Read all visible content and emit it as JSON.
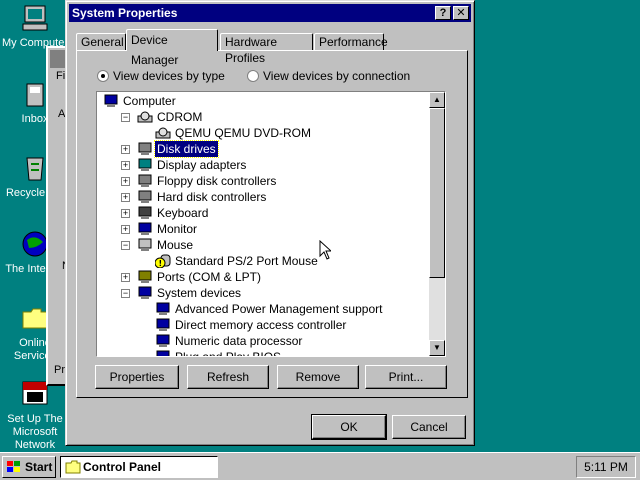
{
  "desktop": {
    "icons": [
      {
        "label": "My Computer",
        "icon": "my-computer-icon"
      },
      {
        "label": "Inbox",
        "icon": "inbox-icon"
      },
      {
        "label": "Recycle Bin",
        "icon": "recycle-bin-icon"
      },
      {
        "label": "The Internet",
        "icon": "internet-icon"
      },
      {
        "label": "Online Services",
        "icon": "folder-icon"
      },
      {
        "label": "Set Up The Microsoft Network",
        "icon": "msn-icon"
      }
    ]
  },
  "background_window": {
    "menu_fragment": "File",
    "fragment_a": "A",
    "fragment_n": "N",
    "fragment_pro": "Pro"
  },
  "dialog": {
    "title": "System Properties",
    "help_button": "?",
    "close_button": "✕",
    "tabs": [
      {
        "label": "General",
        "active": false
      },
      {
        "label": "Device Manager",
        "active": true
      },
      {
        "label": "Hardware Profiles",
        "active": false
      },
      {
        "label": "Performance",
        "active": false
      }
    ],
    "view_options": {
      "by_type": {
        "label": "View devices by type",
        "selected": true
      },
      "by_connection": {
        "label": "View devices by connection",
        "selected": false
      }
    },
    "device_tree": [
      {
        "label": "Computer",
        "icon": "computer-icon",
        "level": 0,
        "expander": ""
      },
      {
        "label": "CDROM",
        "icon": "cdrom-icon",
        "level": 1,
        "expander": "−"
      },
      {
        "label": "QEMU QEMU DVD-ROM",
        "icon": "cdrom-icon",
        "level": 2,
        "expander": ""
      },
      {
        "label": "Disk drives",
        "icon": "disk-drive-icon",
        "level": 1,
        "expander": "+",
        "selected": true
      },
      {
        "label": "Display adapters",
        "icon": "display-adapter-icon",
        "level": 1,
        "expander": "+"
      },
      {
        "label": "Floppy disk controllers",
        "icon": "floppy-controller-icon",
        "level": 1,
        "expander": "+"
      },
      {
        "label": "Hard disk controllers",
        "icon": "hard-disk-controller-icon",
        "level": 1,
        "expander": "+"
      },
      {
        "label": "Keyboard",
        "icon": "keyboard-icon",
        "level": 1,
        "expander": "+"
      },
      {
        "label": "Monitor",
        "icon": "monitor-icon",
        "level": 1,
        "expander": "+"
      },
      {
        "label": "Mouse",
        "icon": "mouse-icon",
        "level": 1,
        "expander": "−"
      },
      {
        "label": "Standard PS/2 Port Mouse",
        "icon": "warning-mouse-icon",
        "level": 2,
        "expander": ""
      },
      {
        "label": "Ports (COM & LPT)",
        "icon": "ports-icon",
        "level": 1,
        "expander": "+"
      },
      {
        "label": "System devices",
        "icon": "system-devices-icon",
        "level": 1,
        "expander": "−"
      },
      {
        "label": "Advanced Power Management support",
        "icon": "system-device-icon",
        "level": 2,
        "expander": ""
      },
      {
        "label": "Direct memory access controller",
        "icon": "system-device-icon",
        "level": 2,
        "expander": ""
      },
      {
        "label": "Numeric data processor",
        "icon": "system-device-icon",
        "level": 2,
        "expander": ""
      },
      {
        "label": "Plug and Play BIOS",
        "icon": "system-device-icon",
        "level": 2,
        "expander": ""
      }
    ],
    "buttons": {
      "properties": "Properties",
      "refresh": "Refresh",
      "remove": "Remove",
      "print": "Print...",
      "ok": "OK",
      "cancel": "Cancel"
    }
  },
  "taskbar": {
    "start": "Start",
    "task": "Control Panel",
    "clock": "5:11 PM"
  },
  "colors": {
    "desktop": "#008080",
    "titlebar": "#000080",
    "face": "#c0c0c0",
    "selection": "#000080"
  }
}
